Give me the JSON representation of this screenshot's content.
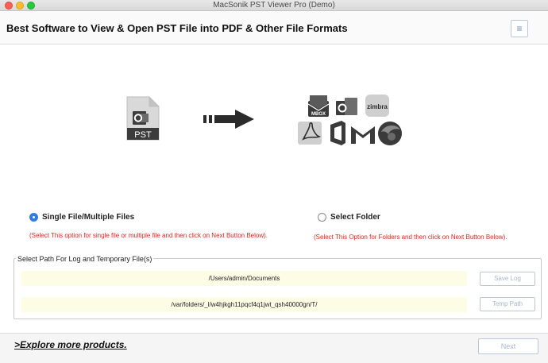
{
  "window": {
    "title": "MacSonik PST Viewer Pro (Demo)"
  },
  "header": {
    "headline": "Best Software to View & Open PST File into PDF & Other File Formats",
    "menu_glyph": "≡"
  },
  "illustration": {
    "source_icon": "pst-file-icon",
    "source_label": "PST",
    "target_icons": [
      "mbox-icon",
      "outlook-icon",
      "zimbra-icon",
      "pdf-icon",
      "office-icon",
      "gmail-icon",
      "thunderbird-icon"
    ],
    "mbox_label": "MBOX",
    "zimbra_label": "zimbra"
  },
  "options": {
    "single": {
      "label": "Single File/Multiple Files",
      "hint": "(Select This option for single file or multiple file and then click on Next Button Below).",
      "selected": true
    },
    "folder": {
      "label": "Select Folder",
      "hint": "(Select This Option for Folders and then click on Next Button Below).",
      "selected": false
    }
  },
  "paths": {
    "group_label": "Select Path For Log and Temporary File(s)",
    "log_path": "/Users/admin/Documents",
    "temp_path": "/var/folders/_l/w4hjkgh11pqcf4q1jwt_qsh40000gn/T/",
    "save_log_label": "Save Log",
    "temp_path_label": "Temp Path"
  },
  "footer": {
    "explore_label": ">Explore more products.",
    "next_label": "Next"
  },
  "colors": {
    "accent": "#2f7be6",
    "hint_red": "#e0261d",
    "field_bg": "#fdfde6"
  }
}
